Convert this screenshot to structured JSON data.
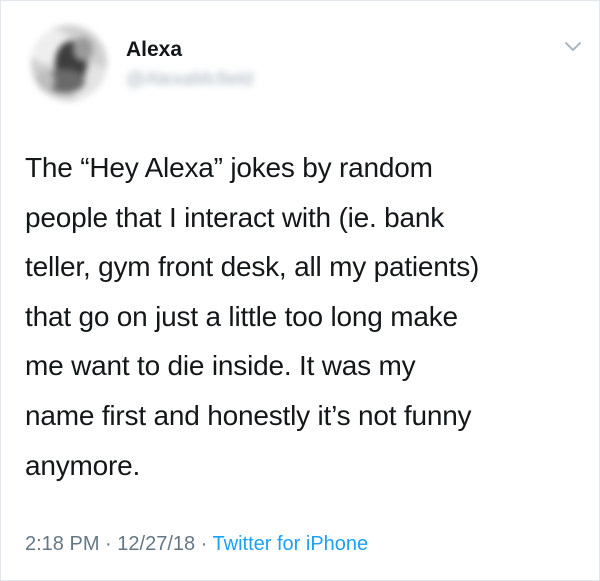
{
  "tweet": {
    "author": {
      "display_name": "Alexa",
      "handle": "@AlexaMcfield"
    },
    "text": "The “Hey Alexa” jokes by random\npeople that I interact with (ie. bank\nteller, gym front desk, all my patients)\nthat go on just a little too long make\nme want to die inside. It was my\nname first and honestly it’s not funny\nanymore.",
    "meta": {
      "time": "2:18 PM",
      "separator": " · ",
      "date": "12/27/18",
      "source": "Twitter for iPhone"
    },
    "icons": {
      "more": "chevron-down-icon"
    }
  },
  "colors": {
    "text_primary": "#14171a",
    "text_secondary": "#657786",
    "link": "#1da1f2",
    "border": "#e1e8ed"
  }
}
